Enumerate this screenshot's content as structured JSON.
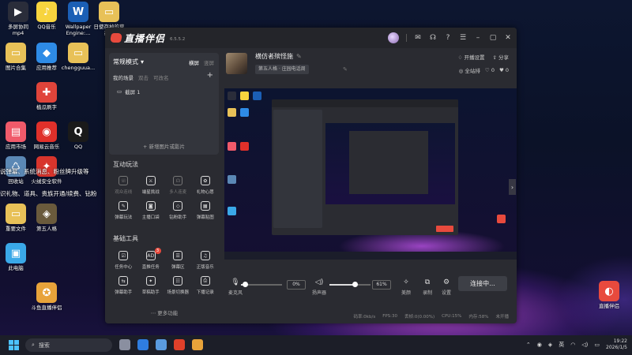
{
  "desktop": {
    "icons": [
      {
        "id": "multi-screen",
        "label": "多屏协同\nmp4",
        "color": "#2a2d3a",
        "glyph": "▶"
      },
      {
        "id": "qq-music",
        "label": "QQ音乐",
        "color": "#f7d43e",
        "glyph": "♪"
      },
      {
        "id": "wallpaper-engine",
        "label": "Wallpaper\nEngine:...",
        "color": "#1b5fb5",
        "glyph": "W"
      },
      {
        "id": "mystery-folder",
        "label": "日使存掉的草\n墨...",
        "color": "#e8c158",
        "glyph": "▭"
      },
      {
        "id": "images",
        "label": "图片合集",
        "color": "#e8c158",
        "glyph": "▭"
      },
      {
        "id": "app-recommend",
        "label": "应用推荐",
        "color": "#2e8be6",
        "glyph": "◆"
      },
      {
        "id": "chengguang",
        "label": "chengguua...",
        "color": "#e8c158",
        "glyph": "▭"
      },
      {
        "id": "melon",
        "label": "植瓜刷字",
        "color": "#e0443a",
        "glyph": "✚"
      },
      {
        "id": "app-market",
        "label": "应用市场",
        "color": "#f05a6a",
        "glyph": "▤"
      },
      {
        "id": "netease-music",
        "label": "网易云音乐",
        "color": "#e0302a",
        "glyph": "◉"
      },
      {
        "id": "qq",
        "label": "QQ",
        "color": "#1a1a1a",
        "glyph": "Q"
      },
      {
        "id": "recycle",
        "label": "回收站",
        "color": "#5b88b5",
        "glyph": "♺"
      },
      {
        "id": "huorong",
        "label": "火绒安全软件",
        "color": "#d8342c",
        "glyph": "✦"
      },
      {
        "id": "important-files",
        "label": "重要文件",
        "color": "#e8c158",
        "glyph": "▭"
      },
      {
        "id": "identity-v",
        "label": "第五人格",
        "color": "#6a5a3c",
        "glyph": "◈"
      },
      {
        "id": "this-pc",
        "label": "此电脑",
        "color": "#3aa8e8",
        "glyph": "▣"
      },
      {
        "id": "douyu-companion",
        "label": "斗鱼直播伴侣",
        "color": "#e8a33a",
        "glyph": "✪"
      },
      {
        "id": "live-companion",
        "label": "直播伴侣",
        "color": "#e84a3d",
        "glyph": "◐"
      }
    ],
    "toast1": "说弹幕、系统消息、粉丝牌升级等",
    "toast2": "识礼物、道具、贵族开通/续费、钻粉"
  },
  "window": {
    "app_name": "直播伴侣",
    "version": "6.5.5.2",
    "title_icons": [
      "message-icon",
      "headset-icon",
      "help-icon",
      "settings-icon",
      "minimize-icon",
      "maximize-icon",
      "close-icon"
    ]
  },
  "scenes": {
    "mode": "常规模式",
    "orient_landscape": "横屏",
    "orient_portrait": "竖屏",
    "tabs": [
      "我的场景",
      "双击",
      "可改名"
    ],
    "item": "截屏 1",
    "add": "新增图片或影片"
  },
  "interaction": {
    "title": "互动玩法",
    "tools": [
      {
        "label": "观众连线",
        "dim": true,
        "glyph": "☏"
      },
      {
        "label": "端星挑战",
        "dim": false,
        "glyph": "⚔"
      },
      {
        "label": "多人连麦",
        "dim": true,
        "glyph": "☊"
      },
      {
        "label": "礼物心愿",
        "dim": false,
        "glyph": "✿"
      },
      {
        "label": "弹幕玩法",
        "dim": false,
        "glyph": "✎"
      },
      {
        "label": "主播口袋",
        "dim": false,
        "glyph": "◙"
      },
      {
        "label": "钻粉助手",
        "dim": false,
        "glyph": "◇"
      },
      {
        "label": "弹幕贴图",
        "dim": false,
        "glyph": "▦"
      }
    ]
  },
  "basic": {
    "title": "基础工具",
    "tools": [
      {
        "label": "任务中心",
        "glyph": "☑",
        "badge": ""
      },
      {
        "label": "直推任务",
        "glyph": "AD",
        "badge": "3"
      },
      {
        "label": "弹幕区",
        "glyph": "☰",
        "badge": ""
      },
      {
        "label": "正版音乐",
        "glyph": "♫",
        "badge": ""
      },
      {
        "label": "弹幕助手",
        "glyph": "⇆",
        "badge": ""
      },
      {
        "label": "草稿助手",
        "glyph": "✦",
        "badge": ""
      },
      {
        "label": "场景切换器",
        "glyph": "☷",
        "badge": ""
      },
      {
        "label": "下播记录",
        "glyph": "⎙",
        "badge": ""
      }
    ],
    "more": "更多功能"
  },
  "room": {
    "title": "横仿者殡怪施",
    "category": "第五人格 · 庄园电话周",
    "start_setting": "开播设置",
    "share": "分享",
    "followers_label": "全站排",
    "likes": "0",
    "hearts": "0"
  },
  "controls": {
    "mic_label": "麦克风",
    "mic_value": "0%",
    "mic_level": 0.1,
    "speaker_label": "扬声器",
    "speaker_value": "61%",
    "speaker_level": 0.61,
    "effects_label": "美颜",
    "record_label": "录制",
    "settings_label": "设置",
    "go_live": "连接中..."
  },
  "status": {
    "bitrate": "码率:0kb/s",
    "fps": "FPS:30",
    "dropped": "丢帧:0(0.00%)",
    "cpu": "CPU:15%",
    "memory": "内存:58%",
    "network": "未开播"
  },
  "taskbar": {
    "search": "搜索",
    "lang": "英",
    "time": "19:22",
    "date": "2026/1/5",
    "apps": [
      "#8a8fa0",
      "#2f7de0",
      "#5a9be0",
      "#e0402a",
      "#e8a33a"
    ]
  }
}
